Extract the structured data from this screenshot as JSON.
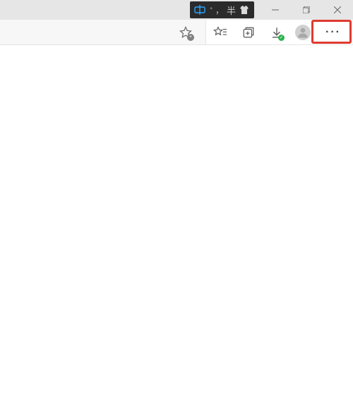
{
  "titlebar": {
    "ime": {
      "mode_cn": "中",
      "punct": "，",
      "half_full": "半"
    },
    "minimize": "Minimize",
    "maximize": "Maximize",
    "close": "Close"
  },
  "toolbar": {
    "add_favorite": "Add this page to favorites",
    "favorites": "Favorites",
    "collections": "Collections",
    "downloads": "Downloads",
    "profile": "Profile",
    "settings_more": "Settings and more"
  },
  "icons": {
    "star": "star-icon",
    "favorites_list": "favorites-list-icon",
    "collections": "collections-icon",
    "download": "download-icon",
    "profile": "profile-icon",
    "more": "more-icon",
    "ime_cn": "ime-cn-icon",
    "ime_shirt": "ime-skin-icon"
  },
  "highlight": {
    "target": "settings-more-button"
  }
}
